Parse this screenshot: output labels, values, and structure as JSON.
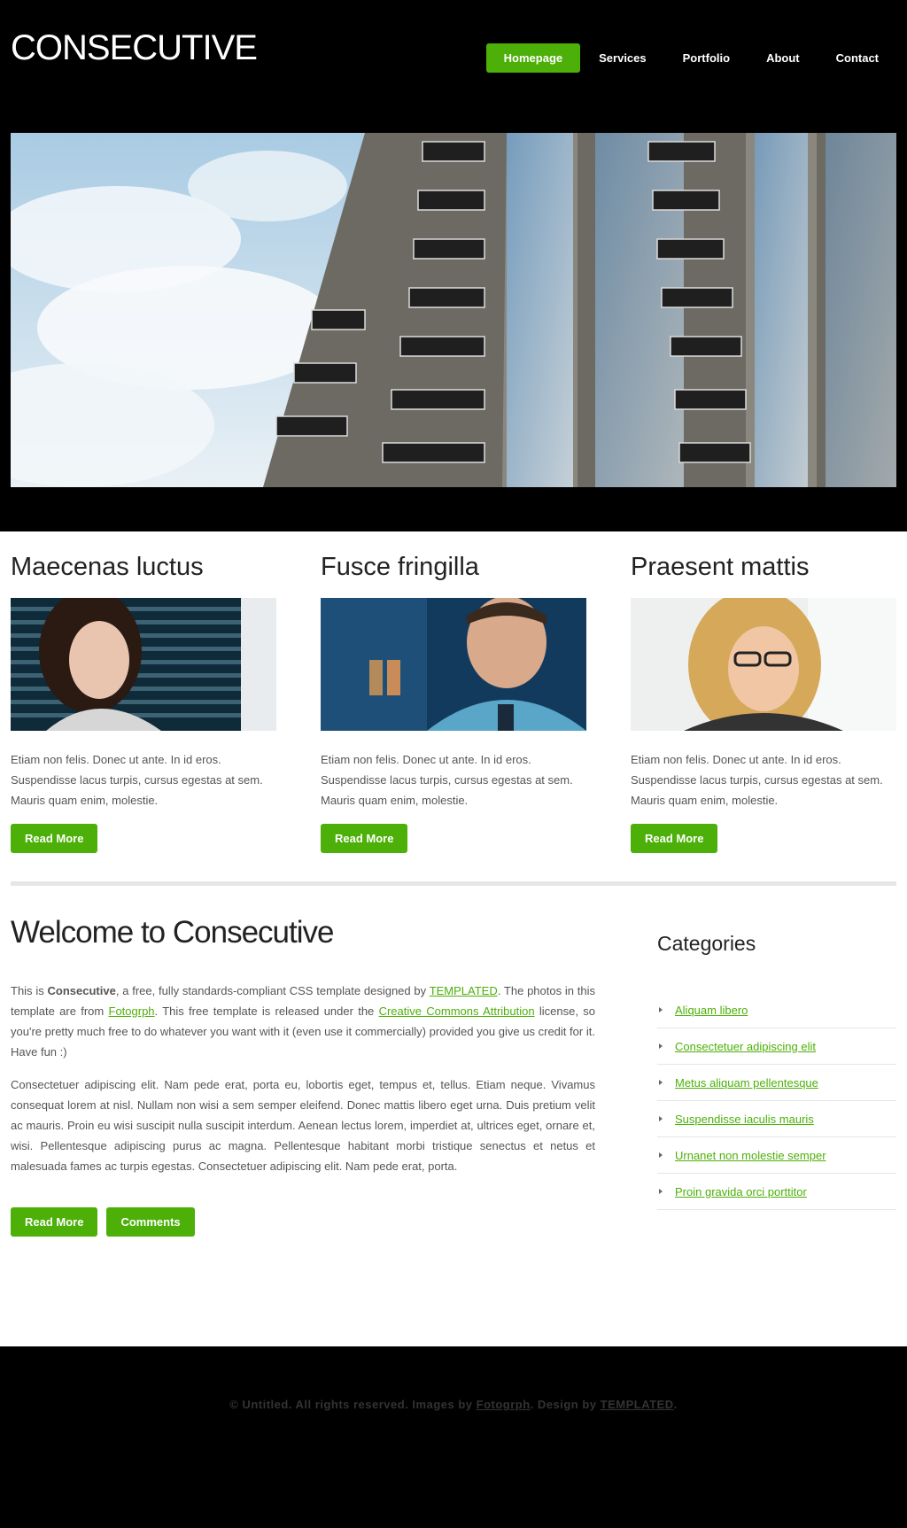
{
  "header": {
    "logo": "CONSECUTIVE",
    "nav": [
      {
        "label": "Homepage",
        "active": true
      },
      {
        "label": "Services",
        "active": false
      },
      {
        "label": "Portfolio",
        "active": false
      },
      {
        "label": "About",
        "active": false
      },
      {
        "label": "Contact",
        "active": false
      }
    ]
  },
  "columns": [
    {
      "title": "Maecenas luctus",
      "text": "Etiam non felis. Donec ut ante. In id eros. Suspendisse lacus turpis, cursus egestas at sem. Mauris quam enim, molestie.",
      "button": "Read More"
    },
    {
      "title": "Fusce fringilla",
      "text": "Etiam non felis. Donec ut ante. In id eros. Suspendisse lacus turpis, cursus egestas at sem. Mauris quam enim, molestie.",
      "button": "Read More"
    },
    {
      "title": "Praesent mattis",
      "text": "Etiam non felis. Donec ut ante. In id eros. Suspendisse lacus turpis, cursus egestas at sem. Mauris quam enim, molestie.",
      "button": "Read More"
    }
  ],
  "content": {
    "title": "Welcome to Consecutive",
    "p1": {
      "t1": "This is ",
      "brand": "Consecutive",
      "t2": ", a free, fully standards-compliant CSS template designed by ",
      "link1": "TEMPLATED",
      "t3": ". The photos in this template are from ",
      "link2": "Fotogrph",
      "t4": ". This free template is released under the ",
      "link3": "Creative Commons Attribution",
      "t5": " license, so you're pretty much free to do whatever you want with it (even use it commercially) provided you give us credit for it. Have fun :)"
    },
    "p2": "Consectetuer adipiscing elit. Nam pede erat, porta eu, lobortis eget, tempus et, tellus. Etiam neque. Vivamus consequat lorem at nisl. Nullam non wisi a sem semper eleifend. Donec mattis libero eget urna. Duis pretium velit ac mauris. Proin eu wisi suscipit nulla suscipit interdum. Aenean lectus lorem, imperdiet at, ultrices eget, ornare et, wisi. Pellentesque adipiscing purus ac magna. Pellentesque habitant morbi tristique senectus et netus et malesuada fames ac turpis egestas. Consectetuer adipiscing elit. Nam pede erat, porta.",
    "read_more": "Read More",
    "comments": "Comments"
  },
  "sidebar": {
    "title": "Categories",
    "items": [
      "Aliquam libero",
      "Consectetuer adipiscing elit",
      "Metus aliquam pellentesque",
      "Suspendisse iaculis mauris",
      "Urnanet non molestie semper",
      "Proin gravida orci porttitor"
    ]
  },
  "footer": {
    "t1": "© Untitled. All rights reserved. Images by ",
    "link1": "Fotogrph",
    "t2": ". Design by ",
    "link2": "TEMPLATED",
    "t3": "."
  },
  "colors": {
    "accent": "#4cb008",
    "header_bg": "#000000"
  }
}
